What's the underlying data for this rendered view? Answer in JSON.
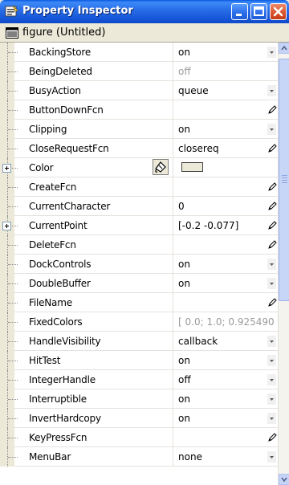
{
  "window": {
    "title": "Property Inspector",
    "object_label": "figure (Untitled)"
  },
  "properties": [
    {
      "name": "BackingStore",
      "value": "on",
      "control": "dropdown",
      "expandable": false,
      "grey": false
    },
    {
      "name": "BeingDeleted",
      "value": "off",
      "control": "none",
      "expandable": false,
      "grey": true
    },
    {
      "name": "BusyAction",
      "value": "queue",
      "control": "dropdown",
      "expandable": false,
      "grey": false
    },
    {
      "name": "ButtonDownFcn",
      "value": "",
      "control": "pencil",
      "expandable": false,
      "grey": false
    },
    {
      "name": "Clipping",
      "value": "on",
      "control": "dropdown",
      "expandable": false,
      "grey": false
    },
    {
      "name": "CloseRequestFcn",
      "value": "closereq",
      "control": "pencil",
      "expandable": false,
      "grey": false
    },
    {
      "name": "Color",
      "value": "",
      "control": "color",
      "expandable": true,
      "grey": false
    },
    {
      "name": "CreateFcn",
      "value": "",
      "control": "pencil",
      "expandable": false,
      "grey": false
    },
    {
      "name": "CurrentCharacter",
      "value": "0",
      "control": "pencil",
      "expandable": false,
      "grey": false
    },
    {
      "name": "CurrentPoint",
      "value": "[-0.2 -0.077]",
      "control": "pencil",
      "expandable": true,
      "grey": false
    },
    {
      "name": "DeleteFcn",
      "value": "",
      "control": "pencil",
      "expandable": false,
      "grey": false
    },
    {
      "name": "DockControls",
      "value": "on",
      "control": "dropdown",
      "expandable": false,
      "grey": false
    },
    {
      "name": "DoubleBuffer",
      "value": "on",
      "control": "dropdown",
      "expandable": false,
      "grey": false
    },
    {
      "name": "FileName",
      "value": "",
      "control": "pencil",
      "expandable": false,
      "grey": false
    },
    {
      "name": "FixedColors",
      "value": "[ 0.0; 1.0; 0.925490...",
      "control": "none",
      "expandable": false,
      "grey": true
    },
    {
      "name": "HandleVisibility",
      "value": "callback",
      "control": "dropdown",
      "expandable": false,
      "grey": false
    },
    {
      "name": "HitTest",
      "value": "on",
      "control": "dropdown",
      "expandable": false,
      "grey": false
    },
    {
      "name": "IntegerHandle",
      "value": "off",
      "control": "dropdown",
      "expandable": false,
      "grey": false
    },
    {
      "name": "Interruptible",
      "value": "on",
      "control": "dropdown",
      "expandable": false,
      "grey": false
    },
    {
      "name": "InvertHardcopy",
      "value": "on",
      "control": "dropdown",
      "expandable": false,
      "grey": false
    },
    {
      "name": "KeyPressFcn",
      "value": "",
      "control": "pencil",
      "expandable": false,
      "grey": false
    },
    {
      "name": "MenuBar",
      "value": "none",
      "control": "dropdown",
      "expandable": false,
      "grey": false
    }
  ],
  "icons": {
    "title": "property-inspector-icon",
    "object": "figure-icon",
    "minimize": "minimize-icon",
    "maximize": "maximize-icon",
    "close": "close-icon",
    "dropdown": "chevron-down-icon",
    "pencil": "pencil-icon",
    "color_picker": "palette-icon"
  },
  "colors": {
    "titlebar": "#2a6fe8",
    "close_button": "#d9522a",
    "grid_background": "#ffffff",
    "panel_background": "#ece9d8",
    "grey_value": "#9a9a9a",
    "color_swatch": "#ece9d8"
  }
}
